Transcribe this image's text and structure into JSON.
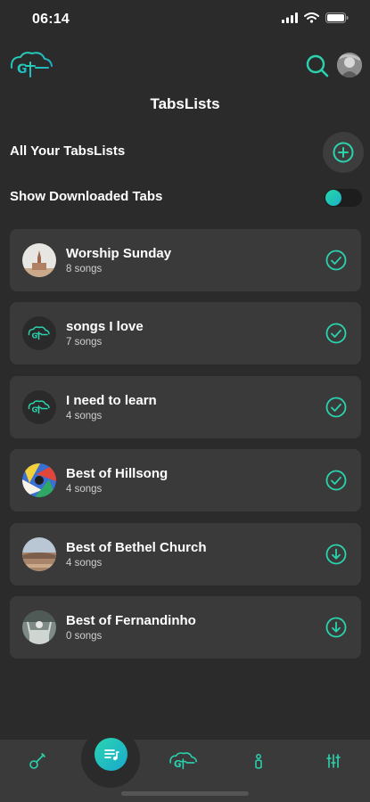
{
  "status_bar": {
    "time": "06:14"
  },
  "header": {
    "title": "TabsLists"
  },
  "section": {
    "title": "All Your TabsLists"
  },
  "downloaded_toggle": {
    "label": "Show Downloaded Tabs",
    "on": true
  },
  "playlists": [
    {
      "name": "Worship Sunday",
      "count": "8 songs",
      "status": "downloaded",
      "thumb": "church-photo"
    },
    {
      "name": "songs I love",
      "count": "7 songs",
      "status": "downloaded",
      "thumb": "logo"
    },
    {
      "name": "I need to learn",
      "count": "4 songs",
      "status": "downloaded",
      "thumb": "logo"
    },
    {
      "name": "Best of Hillsong",
      "count": "4 songs",
      "status": "downloaded",
      "thumb": "album-art"
    },
    {
      "name": "Best of Bethel Church",
      "count": "4 songs",
      "status": "download",
      "thumb": "landscape-photo"
    },
    {
      "name": "Best of Fernandinho",
      "count": "0 songs",
      "status": "download",
      "thumb": "concert-photo"
    }
  ],
  "colors": {
    "accent": "#2ad3ad",
    "accent_alt": "#1aa8cc",
    "background": "#2b2b2b",
    "card": "#3a3a3a"
  },
  "nav": {
    "items": [
      "guitar-icon",
      "tabslists-icon",
      "logo-icon",
      "tuner-icon",
      "settings-sliders-icon"
    ],
    "active": "tabslists-icon"
  }
}
